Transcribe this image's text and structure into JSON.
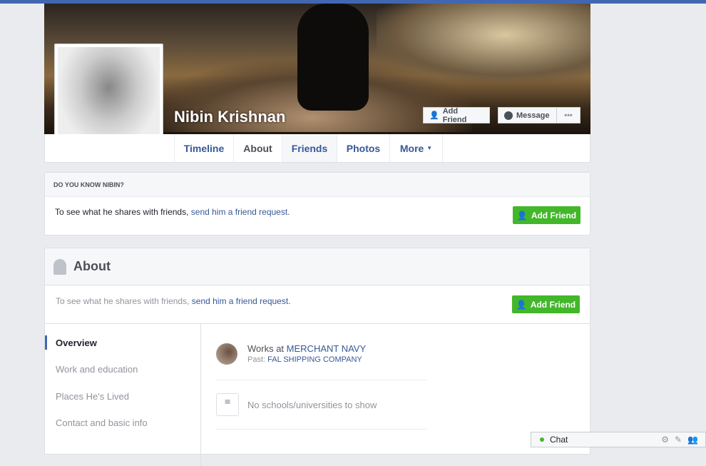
{
  "profile": {
    "name": "Nibin Krishnan"
  },
  "cover_buttons": {
    "add_friend": "Add Friend",
    "message": "Message",
    "more": "•••"
  },
  "tabs": [
    {
      "label": "Timeline"
    },
    {
      "label": "About"
    },
    {
      "label": "Friends"
    },
    {
      "label": "Photos"
    },
    {
      "label": "More"
    }
  ],
  "know": {
    "title": "DO YOU KNOW NIBIN?",
    "text": "To see what he shares with friends, ",
    "link": "send him a friend request.",
    "button": "Add Friend"
  },
  "about": {
    "title": "About",
    "text": "To see what he shares with friends, ",
    "link": "send him a friend request.",
    "button": "Add Friend",
    "nav": [
      {
        "label": "Overview"
      },
      {
        "label": "Work and education"
      },
      {
        "label": "Places He's Lived"
      },
      {
        "label": "Contact and basic info"
      }
    ],
    "work": {
      "prefix": "Works at ",
      "employer": "MERCHANT NAVY",
      "past_label": "Past: ",
      "past": "FAL SHIPPING COMPANY"
    },
    "schools": "No schools/universities to show"
  },
  "chat": {
    "label": "Chat"
  },
  "colors": {
    "accent": "#4267b2",
    "green": "#42b72a",
    "link": "#365899"
  }
}
